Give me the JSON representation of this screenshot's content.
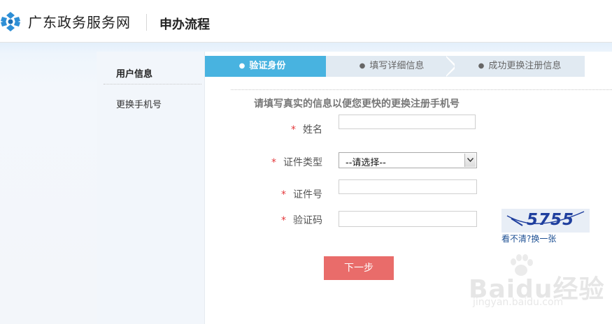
{
  "header": {
    "site_name": "广东政务服务网",
    "process_title": "申办流程"
  },
  "sidebar": {
    "items": [
      {
        "label": "用户信息"
      },
      {
        "label": "更换手机号"
      }
    ]
  },
  "steps": [
    {
      "label": "验证身份",
      "state": "active"
    },
    {
      "label": "填写详细信息",
      "state": "inactive"
    },
    {
      "label": "成功更换注册信息",
      "state": "inactive"
    }
  ],
  "form": {
    "instruction": "请填写真实的信息以便您更快的更换注册手机号",
    "required_mark": "*",
    "name_label": "姓名",
    "name_value": "",
    "id_type_label": "证件类型",
    "id_type_selected": "--请选择--",
    "id_number_label": "证件号",
    "id_number_value": "",
    "captcha_label": "验证码",
    "captcha_value": "",
    "captcha_image_text": "5755",
    "captcha_refresh_link": "看不清?换一张",
    "next_button": "下一步"
  },
  "watermark": {
    "brand": "Baidu经验",
    "url": "jingyan.baidu.com"
  },
  "colors": {
    "active_step": "#48b3e0",
    "inactive_step": "#e1eaf2",
    "next_button": "#e96c6a",
    "required": "#e4393c",
    "link": "#1c4f93"
  },
  "icons": {
    "logo": "guangdong-logo-icon",
    "select_arrow": "chevron-down-icon"
  }
}
